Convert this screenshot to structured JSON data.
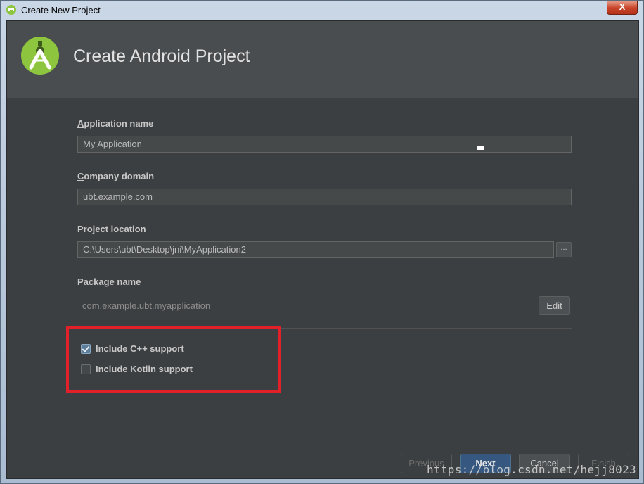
{
  "window": {
    "title": "Create New Project",
    "close_label": "X"
  },
  "header": {
    "title": "Create Android Project"
  },
  "form": {
    "app_name": {
      "label_first": "A",
      "label_rest": "pplication name",
      "value": "My Application"
    },
    "company_domain": {
      "label_first": "C",
      "label_rest": "ompany domain",
      "value": "ubt.example.com"
    },
    "project_location": {
      "label": "Project location",
      "value": "C:\\Users\\ubt\\Desktop\\jni\\MyApplication2",
      "browse_label": "..."
    },
    "package_name": {
      "label": "Package name",
      "value": "com.example.ubt.myapplication",
      "edit_label": "Edit"
    },
    "options": [
      {
        "label": "Include C++ support",
        "checked": true
      },
      {
        "label": "Include Kotlin support",
        "checked": false
      }
    ]
  },
  "footer": {
    "previous": "Previous",
    "next": "Next",
    "cancel": "Cancel",
    "finish": "Finish"
  },
  "watermark": "https://blog.csdn.net/hejj8023",
  "colors": {
    "highlight": "#e1202a",
    "android_green": "#8ec53f",
    "primary_button": "#365880"
  }
}
